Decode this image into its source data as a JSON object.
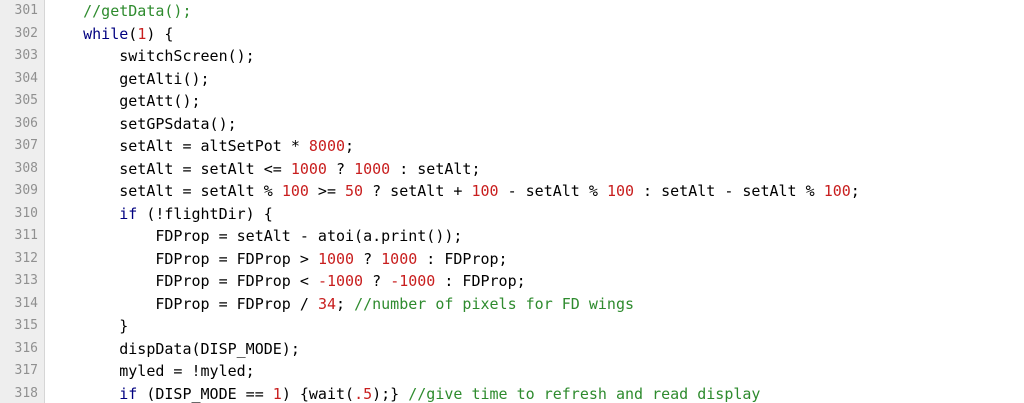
{
  "colors": {
    "comment": "#2e8b2e",
    "keyword": "#000080",
    "number": "#c81e1e",
    "plain": "#000000",
    "line_number": "#909090",
    "gutter_bg": "#eeeeee"
  },
  "lines": [
    {
      "number": "301",
      "tokens": [
        {
          "t": "    ",
          "c": "pl"
        },
        {
          "t": "//getData();",
          "c": "com"
        }
      ]
    },
    {
      "number": "302",
      "tokens": [
        {
          "t": "    ",
          "c": "pl"
        },
        {
          "t": "while",
          "c": "kw"
        },
        {
          "t": "(",
          "c": "pl"
        },
        {
          "t": "1",
          "c": "num"
        },
        {
          "t": ") {",
          "c": "pl"
        }
      ]
    },
    {
      "number": "303",
      "tokens": [
        {
          "t": "        switchScreen();",
          "c": "pl"
        }
      ]
    },
    {
      "number": "304",
      "tokens": [
        {
          "t": "        getAlti();",
          "c": "pl"
        }
      ]
    },
    {
      "number": "305",
      "tokens": [
        {
          "t": "        getAtt();",
          "c": "pl"
        }
      ]
    },
    {
      "number": "306",
      "tokens": [
        {
          "t": "        setGPSdata();",
          "c": "pl"
        }
      ]
    },
    {
      "number": "307",
      "tokens": [
        {
          "t": "        setAlt = altSetPot * ",
          "c": "pl"
        },
        {
          "t": "8000",
          "c": "num"
        },
        {
          "t": ";",
          "c": "pl"
        }
      ]
    },
    {
      "number": "308",
      "tokens": [
        {
          "t": "        setAlt = setAlt <= ",
          "c": "pl"
        },
        {
          "t": "1000",
          "c": "num"
        },
        {
          "t": " ? ",
          "c": "pl"
        },
        {
          "t": "1000",
          "c": "num"
        },
        {
          "t": " : setAlt;",
          "c": "pl"
        }
      ]
    },
    {
      "number": "309",
      "tokens": [
        {
          "t": "        setAlt = setAlt % ",
          "c": "pl"
        },
        {
          "t": "100",
          "c": "num"
        },
        {
          "t": " >= ",
          "c": "pl"
        },
        {
          "t": "50",
          "c": "num"
        },
        {
          "t": " ? setAlt + ",
          "c": "pl"
        },
        {
          "t": "100",
          "c": "num"
        },
        {
          "t": " - setAlt % ",
          "c": "pl"
        },
        {
          "t": "100",
          "c": "num"
        },
        {
          "t": " : setAlt - setAlt % ",
          "c": "pl"
        },
        {
          "t": "100",
          "c": "num"
        },
        {
          "t": ";",
          "c": "pl"
        }
      ]
    },
    {
      "number": "310",
      "tokens": [
        {
          "t": "        ",
          "c": "pl"
        },
        {
          "t": "if",
          "c": "kw"
        },
        {
          "t": " (!flightDir) {",
          "c": "pl"
        }
      ]
    },
    {
      "number": "311",
      "tokens": [
        {
          "t": "            FDProp = setAlt - atoi(a.print());",
          "c": "pl"
        }
      ]
    },
    {
      "number": "312",
      "tokens": [
        {
          "t": "            FDProp = FDProp > ",
          "c": "pl"
        },
        {
          "t": "1000",
          "c": "num"
        },
        {
          "t": " ? ",
          "c": "pl"
        },
        {
          "t": "1000",
          "c": "num"
        },
        {
          "t": " : FDProp;",
          "c": "pl"
        }
      ]
    },
    {
      "number": "313",
      "tokens": [
        {
          "t": "            FDProp = FDProp < ",
          "c": "pl"
        },
        {
          "t": "-1000",
          "c": "num"
        },
        {
          "t": " ? ",
          "c": "pl"
        },
        {
          "t": "-1000",
          "c": "num"
        },
        {
          "t": " : FDProp;",
          "c": "pl"
        }
      ]
    },
    {
      "number": "314",
      "tokens": [
        {
          "t": "            FDProp = FDProp / ",
          "c": "pl"
        },
        {
          "t": "34",
          "c": "num"
        },
        {
          "t": "; ",
          "c": "pl"
        },
        {
          "t": "//number of pixels for FD wings",
          "c": "com"
        }
      ]
    },
    {
      "number": "315",
      "tokens": [
        {
          "t": "        }",
          "c": "pl"
        }
      ]
    },
    {
      "number": "316",
      "tokens": [
        {
          "t": "        dispData(DISP_MODE);",
          "c": "pl"
        }
      ]
    },
    {
      "number": "317",
      "tokens": [
        {
          "t": "        myled = !myled;",
          "c": "pl"
        }
      ]
    },
    {
      "number": "318",
      "tokens": [
        {
          "t": "        ",
          "c": "pl"
        },
        {
          "t": "if",
          "c": "kw"
        },
        {
          "t": " (DISP_MODE == ",
          "c": "pl"
        },
        {
          "t": "1",
          "c": "num"
        },
        {
          "t": ") {wait(",
          "c": "pl"
        },
        {
          "t": ".5",
          "c": "num"
        },
        {
          "t": ");} ",
          "c": "pl"
        },
        {
          "t": "//give time to refresh and read display",
          "c": "com"
        }
      ]
    }
  ]
}
